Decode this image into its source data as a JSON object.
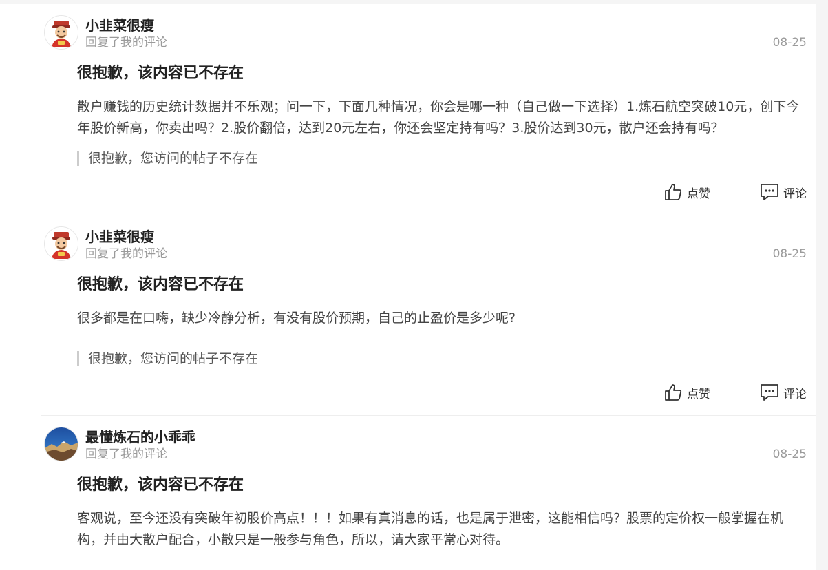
{
  "feed": {
    "items": [
      {
        "avatar_icon": "cartoon-god-of-wealth-avatar",
        "user_name": "小韭菜很瘦",
        "action": "回复了我的评论",
        "date": "08-25",
        "title": "很抱歉，该内容已不存在",
        "content": "散户赚钱的历史统计数据并不乐观；问一下，下面几种情况，你会是哪一种（自己做一下选择）1.炼石航空突破10元，创下今年股价新高，你卖出吗？2.股价翻倍，达到20元左右，你还会坚定持有吗？3.股价达到30元，散户还会持有吗？",
        "quote": "很抱歉，您访问的帖子不存在",
        "like_label": "点赞",
        "comment_label": "评论"
      },
      {
        "avatar_icon": "cartoon-god-of-wealth-avatar",
        "user_name": "小韭菜很瘦",
        "action": "回复了我的评论",
        "date": "08-25",
        "title": "很抱歉，该内容已不存在",
        "content": "很多都是在口嗨，缺少冷静分析，有没有股价预期，自己的止盈价是多少呢?",
        "quote": "很抱歉，您访问的帖子不存在",
        "like_label": "点赞",
        "comment_label": "评论"
      },
      {
        "avatar_icon": "landscape-photo-avatar",
        "user_name": "最懂炼石的小乖乖",
        "action": "回复了我的评论",
        "date": "08-25",
        "title": "很抱歉，该内容已不存在",
        "content": "客观说，至今还没有突破年初股价高点！！！如果有真消息的话，也是属于泄密，这能相信吗？股票的定价权一般掌握在机构，并由大散户配合，小散只是一般参与角色，所以，请大家平常心对待。"
      }
    ]
  }
}
